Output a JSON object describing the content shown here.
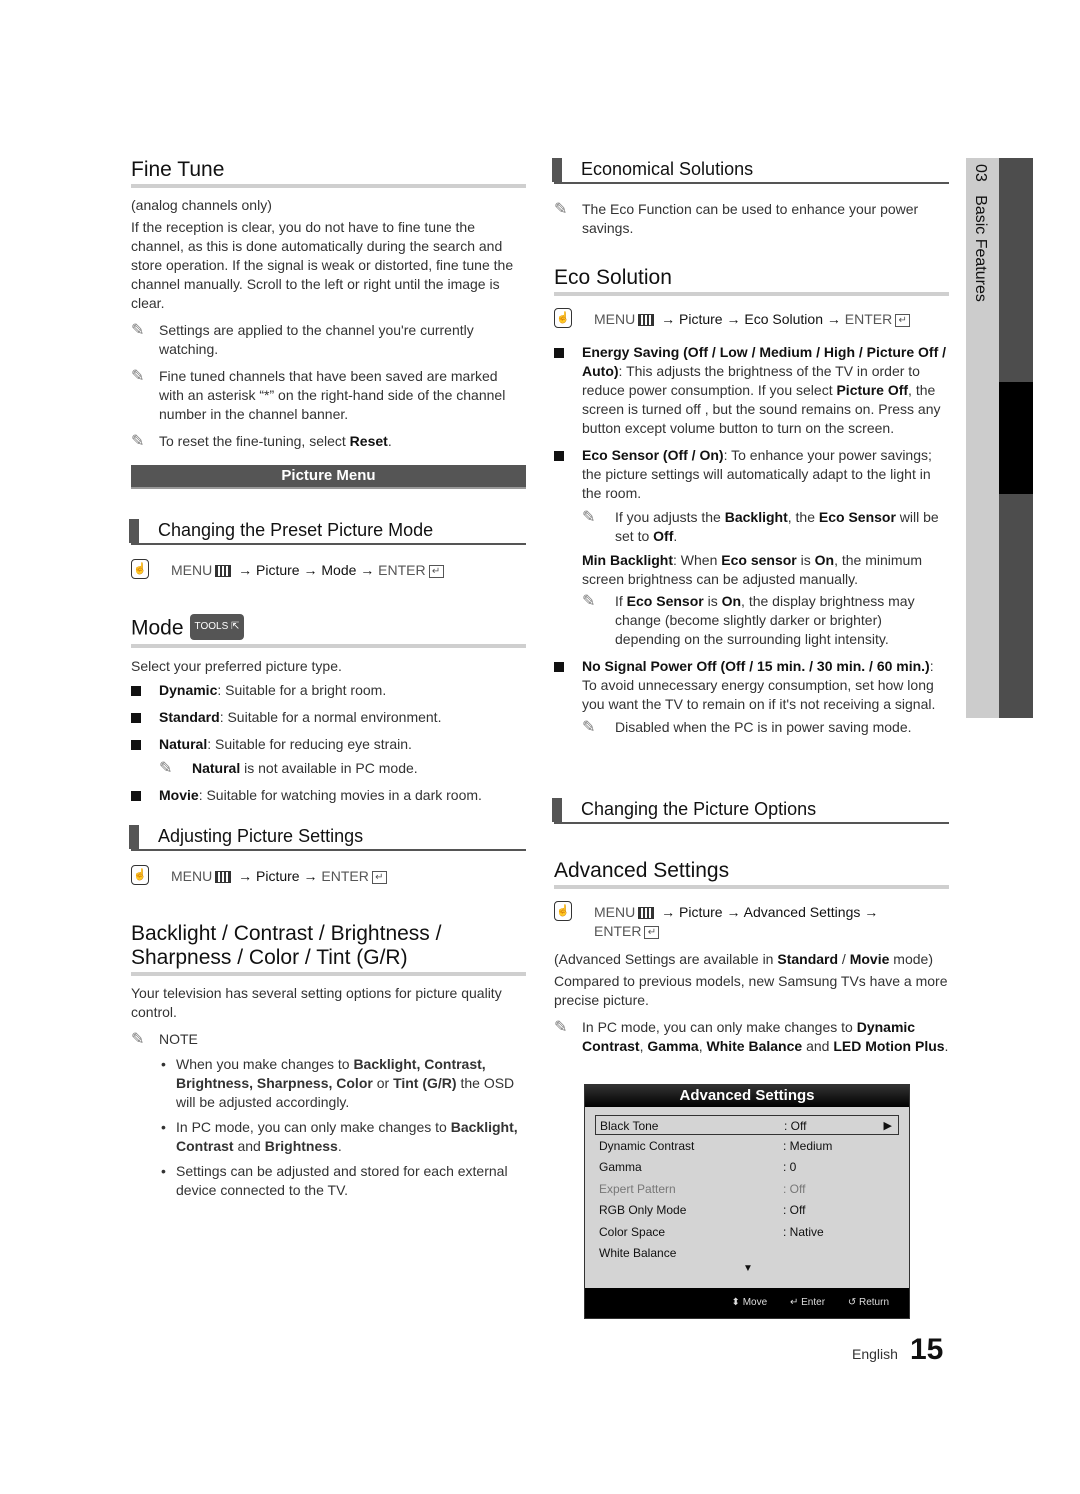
{
  "left": {
    "fine_tune": {
      "title": "Fine Tune",
      "subtitle": "(analog channels only)",
      "body": "If the reception is clear, you do not have to fine tune the channel, as this is done automatically during the search and store operation. If the signal is weak or distorted, fine tune the channel manually. Scroll to the left or right until the image is clear.",
      "notes": [
        "Settings are applied to the channel you're currently watching.",
        "Fine tuned channels that have been saved are marked with an asterisk “*” on the right-hand side of the channel number in the channel banner."
      ],
      "reset_note_prefix": "To reset the fine-tuning, select ",
      "reset_note_bold": "Reset",
      "reset_note_suffix": "."
    },
    "picture_menu_banner": "Picture Menu",
    "preset_mode": {
      "title": "Changing the Preset Picture Mode",
      "menu": {
        "menu": "MENU",
        "path": "→ Picture → Mode →",
        "enter": "ENTER"
      }
    },
    "mode": {
      "title": "Mode",
      "tools_badge": "TOOLS",
      "intro": "Select your preferred picture type.",
      "items": [
        {
          "bold": "Dynamic",
          "text": ": Suitable for a bright room."
        },
        {
          "bold": "Standard",
          "text": ": Suitable for a normal environment."
        },
        {
          "bold": "Natural",
          "text": ": Suitable for reducing eye strain."
        },
        {
          "bold": "Movie",
          "text": ": Suitable for watching movies in a dark room."
        }
      ],
      "natural_note_bold": "Natural",
      "natural_note_text": " is not available in PC mode."
    },
    "adjusting": {
      "title": "Adjusting Picture Settings",
      "menu": {
        "menu": "MENU",
        "path": "→ Picture →",
        "enter": "ENTER"
      }
    },
    "backlight": {
      "title_line1": "Backlight / Contrast / Brightness /",
      "title_line2": "Sharpness / Color / Tint (G/R)",
      "body": "Your television has several setting options for picture quality control.",
      "note_label": "NOTE",
      "bullets": [
        {
          "pre": "When you make changes to ",
          "b1": "Backlight, Contrast, Brightness, Sharpness, Color",
          "mid": " or ",
          "b2": "Tint (G/R)",
          "post": " the OSD will be adjusted accordingly."
        },
        {
          "pre": "In PC mode, you can only make changes to ",
          "b1": "Backlight, Contrast",
          "mid": " and ",
          "b2": "Brightness",
          "post": "."
        },
        {
          "pre": "Settings can be adjusted and stored for each external device connected to the TV.",
          "b1": "",
          "mid": "",
          "b2": "",
          "post": ""
        }
      ]
    }
  },
  "right": {
    "economical": {
      "title": "Economical Solutions",
      "note": "The Eco Function can be used to enhance your power savings."
    },
    "eco_solution": {
      "title": "Eco Solution",
      "menu": {
        "menu": "MENU",
        "path1": "→ ",
        "b1": "Picture",
        "path2": " → ",
        "b2": "Eco Solution",
        "path3": " →",
        "enter": "ENTER"
      },
      "energy_saving_bold": "Energy Saving (Off / Low / Medium / High / Picture Off / Auto)",
      "energy_saving_text1": ": This adjusts the brightness of the TV in order to reduce power consumption. If you select ",
      "energy_saving_bold2": "Picture Off",
      "energy_saving_text2": ", the screen is turned off , but the sound remains on. Press any button except volume button to turn on the screen.",
      "eco_sensor_bold": "Eco Sensor (Off / On)",
      "eco_sensor_text": ": To enhance your power savings; the picture settings will automatically adapt to the light in the room.",
      "eco_sensor_note": {
        "t1": "If you adjusts the ",
        "b1": "Backlight",
        "t2": ", the ",
        "b2": "Eco Sensor",
        "t3": " will be set to ",
        "b3": "Off",
        "t4": "."
      },
      "min_backlight": {
        "b1": "Min Backlight",
        "t1": ": When ",
        "b2": "Eco sensor",
        "t2": " is ",
        "b3": "On",
        "t3": ", the minimum screen brightness can be adjusted manually."
      },
      "min_backlight_note": {
        "t1": "If ",
        "b1": "Eco Sensor",
        "t2": " is ",
        "b2": "On",
        "t3": ", the display brightness may change (become slightly darker or brighter) depending on the surrounding light intensity."
      },
      "no_signal_bold": "No Signal Power Off (Off / 15 min. / 30 min. / 60 min.)",
      "no_signal_text": ": To avoid unnecessary energy consumption, set how long you want the TV to remain on if it's not receiving a signal.",
      "no_signal_note": "Disabled when the PC is in power saving mode."
    },
    "picture_options": {
      "title": "Changing the Picture Options"
    },
    "advanced": {
      "title": "Advanced Settings",
      "menu": {
        "menu": "MENU",
        "path1": "→ ",
        "b1": "Picture",
        "path2": " → ",
        "b2": "Advanced Settings",
        "path3": " →",
        "enter": "ENTER"
      },
      "availability": {
        "t1": "(Advanced Settings are available in ",
        "b1": "Standard",
        "t2": " / ",
        "b2": "Movie",
        "t3": " mode)"
      },
      "body": "Compared to previous models, new Samsung TVs have a more precise picture.",
      "pc_note": {
        "t1": "In PC mode, you can only make changes to ",
        "b1": "Dynamic Contrast",
        "t2": ", ",
        "b2": "Gamma",
        "t3": ", ",
        "b3": "White Balance",
        "t4": " and ",
        "b4": "LED Motion Plus",
        "t5": "."
      }
    },
    "osd": {
      "title": "Advanced Settings",
      "rows": [
        {
          "label": "Black Tone",
          "value": ": Off"
        },
        {
          "label": "Dynamic Contrast",
          "value": ": Medium"
        },
        {
          "label": "Gamma",
          "value": ": 0"
        },
        {
          "label": "Expert Pattern",
          "value": ": Off"
        },
        {
          "label": "RGB Only Mode",
          "value": ": Off"
        },
        {
          "label": "Color Space",
          "value": ": Native"
        },
        {
          "label": "White Balance",
          "value": ""
        }
      ],
      "footer": {
        "move": "Move",
        "enter": "Enter",
        "return": "Return"
      }
    }
  },
  "sidetab": {
    "chapter": "03",
    "label": "Basic Features"
  },
  "footer": {
    "language": "English",
    "page": "15"
  }
}
